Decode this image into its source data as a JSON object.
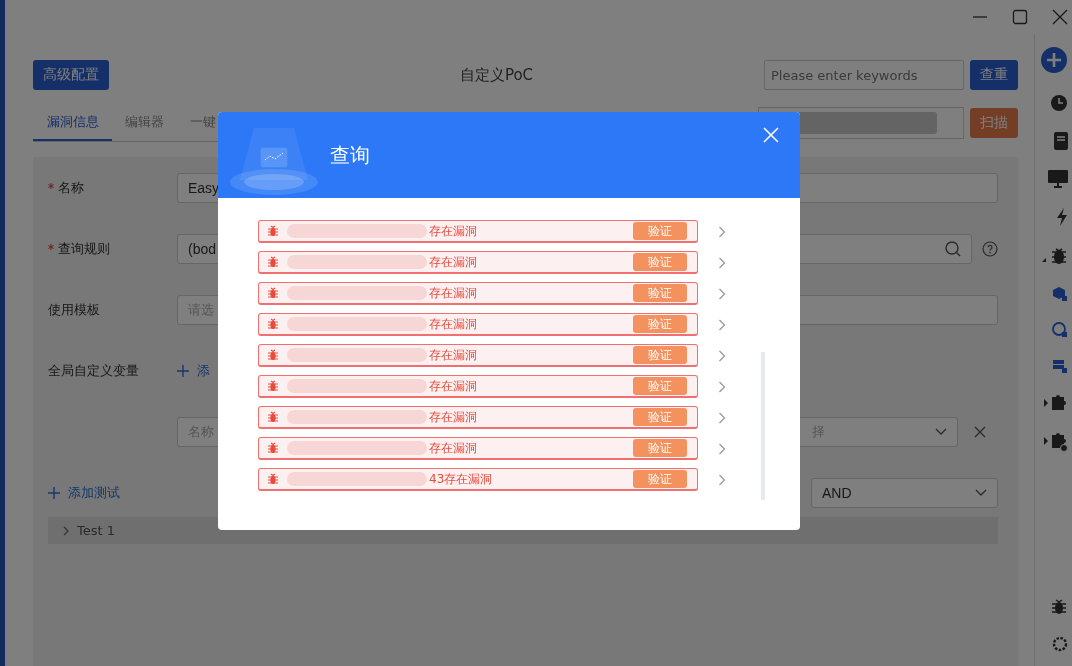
{
  "header": {
    "config_button": "高级配置",
    "title": "自定义PoC",
    "search": {
      "placeholder": "Please enter keywords"
    },
    "dedupe_button": "查重"
  },
  "tabs": [
    {
      "label": "漏洞信息",
      "selected": true
    },
    {
      "label": "编辑器",
      "selected": false
    },
    {
      "label": "一键",
      "selected": false
    }
  ],
  "scan_button": "扫描",
  "form": {
    "fields": [
      {
        "kind": "text",
        "label": "名称",
        "required": true,
        "value": "Easy"
      },
      {
        "kind": "search",
        "label": "查询规则",
        "required": true,
        "value": "(bod"
      },
      {
        "kind": "select",
        "label": "使用模板",
        "required": false,
        "placeholder": "请选"
      }
    ],
    "variables": {
      "label": "全局自定义变量",
      "add_link": "添",
      "name_placeholder": "名称",
      "value_placeholder": "择"
    },
    "add_test": "添加测试",
    "logic": "AND",
    "tests": [
      {
        "label": "Test 1",
        "expanded": false
      }
    ]
  },
  "dialog": {
    "title": "查询",
    "results": [
      {
        "text": "存在漏洞",
        "verify_button": "验证"
      },
      {
        "text": "存在漏洞",
        "verify_button": "验证"
      },
      {
        "text": "存在漏洞",
        "verify_button": "验证"
      },
      {
        "text": "存在漏洞",
        "verify_button": "验证"
      },
      {
        "text": "存在漏洞",
        "verify_button": "验证"
      },
      {
        "text": "存在漏洞",
        "verify_button": "验证"
      },
      {
        "text": "存在漏洞",
        "verify_button": "验证"
      },
      {
        "text": "存在漏洞",
        "verify_button": "验证"
      },
      {
        "text": "43存在漏洞",
        "verify_button": "验证"
      }
    ]
  }
}
